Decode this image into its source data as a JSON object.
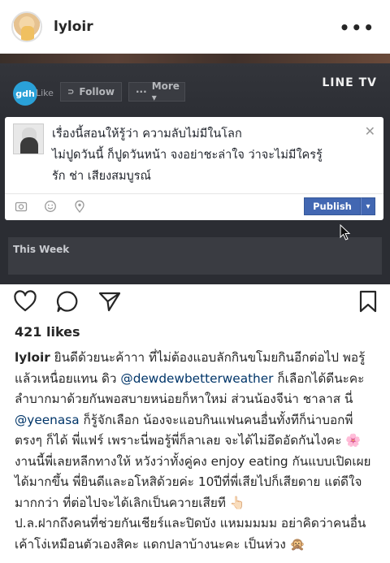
{
  "header": {
    "username": "lyloir",
    "more_icon": "more-horizontal-icon"
  },
  "post_image": {
    "logo_text": "gdh",
    "like_label": "Like",
    "follow_label": "Follow",
    "more_label": "More ▾",
    "brand": "LINE TV",
    "composer": {
      "line1": "เรื่องนี้สอนให้รู้ว่า ความลับไม่มีในโลก",
      "line2": "ไม่ปูดวันนี้ ก็ปูดวันหน้า จงอย่าชะล่าใจ ว่าจะไม่มีใครรู้",
      "line3": "รัก ช่า เสียงสมบูรณ์",
      "close": "✕",
      "publish_label": "Publish",
      "caret": "▾"
    },
    "this_week_label": "This Week"
  },
  "actions": {
    "like_icon": "heart-icon",
    "comment_icon": "comment-icon",
    "share_icon": "send-icon",
    "save_icon": "bookmark-icon"
  },
  "likes_text": "421 likes",
  "caption": {
    "username": "lyloir",
    "part1": " ยินดีด้วยนะค้าาา ที่ไม่ต้องแอบลักกินขโมยกินอีกต่อไป พอรู้แล้วเหนื่อยแทน ดิว ",
    "mention1": "@dewdewbetterweather",
    "part2": " ก็เลือกได้ดีนะคะ ลำบากมาด้วยกันพอสบายหน่อยก็หาใหม่ ส่วนน้องจีน่า ชาลาส นี่ ",
    "mention2": "@yeenasa",
    "part3": " ก็รู้จักเลือก น้องจะแอบกินแฟนคนอื่นทั้งทีก็น่าบอกพี่ตรงๆ ก็ได้ พี่แฟร์ เพราะนี่พอรู้พี่ก็ลาเลย จะได้ไม่อึดอัดกันไงคะ 🌸 งานนี้พี่เลยหลีกทางให้ หวังว่าทั้งคู่คง enjoy eating กันแบบเปิดเผยได้มากขึ้น พี่ยินดีและอโหสิด้วยค่ะ 10ปีที่พี่เสียไปก็เสียดาย แต่ดีใจมากกว่า ที่ต่อไปจะได้เลิกเป็นควายเสียที 👆🏻",
    "ps": "ป.ล.ฝากถึงคนที่ช่วยกันเชียร์และปิดบัง แหมมมมม อย่าคิดว่าคนอื่นเค้าโง่เหมือนตัวเองสิคะ แดกปลาบ้างนะคะ เป็นห่วง 🙊"
  }
}
